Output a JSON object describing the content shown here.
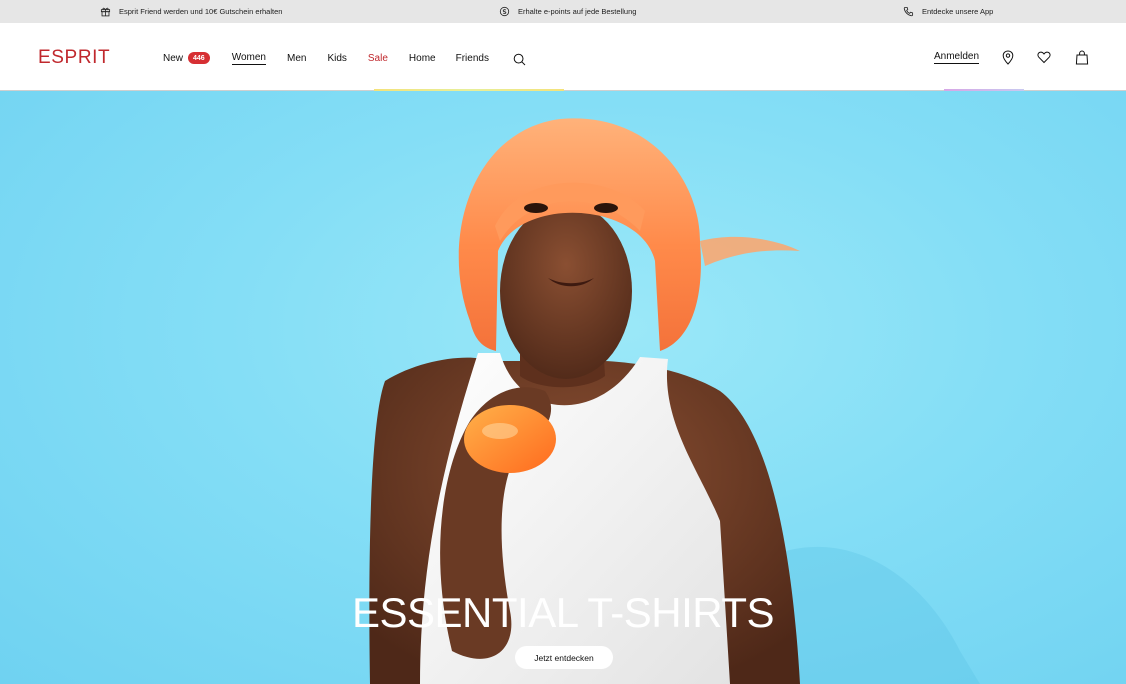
{
  "promo_bar": {
    "left_text": "Esprit Friend werden und 10€ Gutschein erhalten",
    "left_icon": "gift-icon",
    "mid_text": "Erhalte e-points auf jede Bestellung",
    "mid_icon": "coin-icon",
    "right_text": "Entdecke unsere App",
    "right_icon": "phone-icon"
  },
  "header": {
    "logo_text": "ESPRIT",
    "brand_color": "#c0282d",
    "nav": {
      "new_label": "New",
      "new_badge": "446",
      "women_label": "Women",
      "men_label": "Men",
      "kids_label": "Kids",
      "sale_label": "Sale",
      "home_label": "Home",
      "friends_label": "Friends"
    },
    "search_icon": "search-icon",
    "signin_label": "Anmelden",
    "icons": [
      "store-locator-icon",
      "heart-icon",
      "shopping-bag-icon"
    ]
  },
  "hero": {
    "title": "ESSENTIAL T-SHIRTS",
    "cta_label": "Jetzt entdecken",
    "background_color": "#84def6"
  }
}
